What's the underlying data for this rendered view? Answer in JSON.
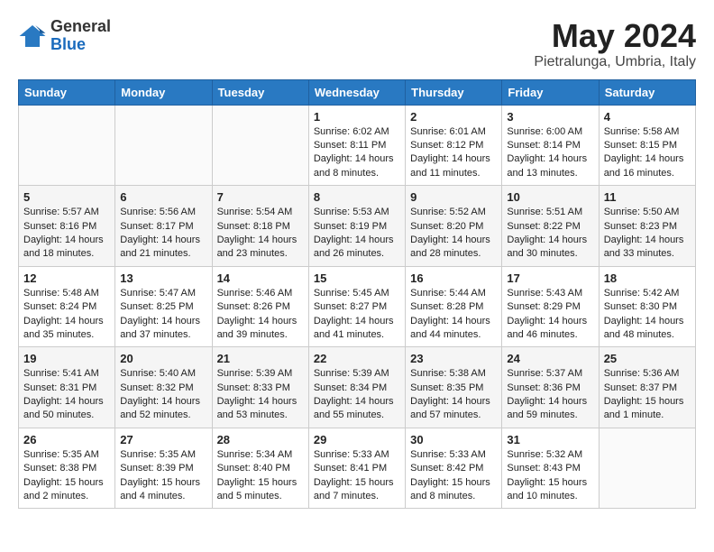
{
  "header": {
    "logo_general": "General",
    "logo_blue": "Blue",
    "month_title": "May 2024",
    "subtitle": "Pietralunga, Umbria, Italy"
  },
  "days_of_week": [
    "Sunday",
    "Monday",
    "Tuesday",
    "Wednesday",
    "Thursday",
    "Friday",
    "Saturday"
  ],
  "weeks": [
    [
      {
        "day": "",
        "info": ""
      },
      {
        "day": "",
        "info": ""
      },
      {
        "day": "",
        "info": ""
      },
      {
        "day": "1",
        "info": "Sunrise: 6:02 AM\nSunset: 8:11 PM\nDaylight: 14 hours\nand 8 minutes."
      },
      {
        "day": "2",
        "info": "Sunrise: 6:01 AM\nSunset: 8:12 PM\nDaylight: 14 hours\nand 11 minutes."
      },
      {
        "day": "3",
        "info": "Sunrise: 6:00 AM\nSunset: 8:14 PM\nDaylight: 14 hours\nand 13 minutes."
      },
      {
        "day": "4",
        "info": "Sunrise: 5:58 AM\nSunset: 8:15 PM\nDaylight: 14 hours\nand 16 minutes."
      }
    ],
    [
      {
        "day": "5",
        "info": "Sunrise: 5:57 AM\nSunset: 8:16 PM\nDaylight: 14 hours\nand 18 minutes."
      },
      {
        "day": "6",
        "info": "Sunrise: 5:56 AM\nSunset: 8:17 PM\nDaylight: 14 hours\nand 21 minutes."
      },
      {
        "day": "7",
        "info": "Sunrise: 5:54 AM\nSunset: 8:18 PM\nDaylight: 14 hours\nand 23 minutes."
      },
      {
        "day": "8",
        "info": "Sunrise: 5:53 AM\nSunset: 8:19 PM\nDaylight: 14 hours\nand 26 minutes."
      },
      {
        "day": "9",
        "info": "Sunrise: 5:52 AM\nSunset: 8:20 PM\nDaylight: 14 hours\nand 28 minutes."
      },
      {
        "day": "10",
        "info": "Sunrise: 5:51 AM\nSunset: 8:22 PM\nDaylight: 14 hours\nand 30 minutes."
      },
      {
        "day": "11",
        "info": "Sunrise: 5:50 AM\nSunset: 8:23 PM\nDaylight: 14 hours\nand 33 minutes."
      }
    ],
    [
      {
        "day": "12",
        "info": "Sunrise: 5:48 AM\nSunset: 8:24 PM\nDaylight: 14 hours\nand 35 minutes."
      },
      {
        "day": "13",
        "info": "Sunrise: 5:47 AM\nSunset: 8:25 PM\nDaylight: 14 hours\nand 37 minutes."
      },
      {
        "day": "14",
        "info": "Sunrise: 5:46 AM\nSunset: 8:26 PM\nDaylight: 14 hours\nand 39 minutes."
      },
      {
        "day": "15",
        "info": "Sunrise: 5:45 AM\nSunset: 8:27 PM\nDaylight: 14 hours\nand 41 minutes."
      },
      {
        "day": "16",
        "info": "Sunrise: 5:44 AM\nSunset: 8:28 PM\nDaylight: 14 hours\nand 44 minutes."
      },
      {
        "day": "17",
        "info": "Sunrise: 5:43 AM\nSunset: 8:29 PM\nDaylight: 14 hours\nand 46 minutes."
      },
      {
        "day": "18",
        "info": "Sunrise: 5:42 AM\nSunset: 8:30 PM\nDaylight: 14 hours\nand 48 minutes."
      }
    ],
    [
      {
        "day": "19",
        "info": "Sunrise: 5:41 AM\nSunset: 8:31 PM\nDaylight: 14 hours\nand 50 minutes."
      },
      {
        "day": "20",
        "info": "Sunrise: 5:40 AM\nSunset: 8:32 PM\nDaylight: 14 hours\nand 52 minutes."
      },
      {
        "day": "21",
        "info": "Sunrise: 5:39 AM\nSunset: 8:33 PM\nDaylight: 14 hours\nand 53 minutes."
      },
      {
        "day": "22",
        "info": "Sunrise: 5:39 AM\nSunset: 8:34 PM\nDaylight: 14 hours\nand 55 minutes."
      },
      {
        "day": "23",
        "info": "Sunrise: 5:38 AM\nSunset: 8:35 PM\nDaylight: 14 hours\nand 57 minutes."
      },
      {
        "day": "24",
        "info": "Sunrise: 5:37 AM\nSunset: 8:36 PM\nDaylight: 14 hours\nand 59 minutes."
      },
      {
        "day": "25",
        "info": "Sunrise: 5:36 AM\nSunset: 8:37 PM\nDaylight: 15 hours\nand 1 minute."
      }
    ],
    [
      {
        "day": "26",
        "info": "Sunrise: 5:35 AM\nSunset: 8:38 PM\nDaylight: 15 hours\nand 2 minutes."
      },
      {
        "day": "27",
        "info": "Sunrise: 5:35 AM\nSunset: 8:39 PM\nDaylight: 15 hours\nand 4 minutes."
      },
      {
        "day": "28",
        "info": "Sunrise: 5:34 AM\nSunset: 8:40 PM\nDaylight: 15 hours\nand 5 minutes."
      },
      {
        "day": "29",
        "info": "Sunrise: 5:33 AM\nSunset: 8:41 PM\nDaylight: 15 hours\nand 7 minutes."
      },
      {
        "day": "30",
        "info": "Sunrise: 5:33 AM\nSunset: 8:42 PM\nDaylight: 15 hours\nand 8 minutes."
      },
      {
        "day": "31",
        "info": "Sunrise: 5:32 AM\nSunset: 8:43 PM\nDaylight: 15 hours\nand 10 minutes."
      },
      {
        "day": "",
        "info": ""
      }
    ]
  ]
}
